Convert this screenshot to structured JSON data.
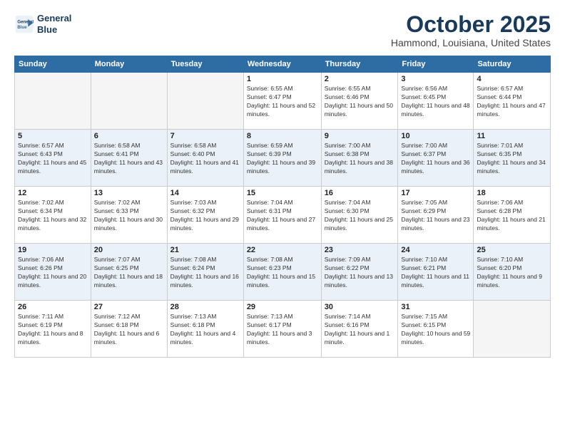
{
  "header": {
    "logo_line1": "General",
    "logo_line2": "Blue",
    "month": "October 2025",
    "location": "Hammond, Louisiana, United States"
  },
  "weekdays": [
    "Sunday",
    "Monday",
    "Tuesday",
    "Wednesday",
    "Thursday",
    "Friday",
    "Saturday"
  ],
  "weeks": [
    [
      {
        "day": "",
        "empty": true
      },
      {
        "day": "",
        "empty": true
      },
      {
        "day": "",
        "empty": true
      },
      {
        "day": "1",
        "sunrise": "6:55 AM",
        "sunset": "6:47 PM",
        "daylight": "11 hours and 52 minutes."
      },
      {
        "day": "2",
        "sunrise": "6:55 AM",
        "sunset": "6:46 PM",
        "daylight": "11 hours and 50 minutes."
      },
      {
        "day": "3",
        "sunrise": "6:56 AM",
        "sunset": "6:45 PM",
        "daylight": "11 hours and 48 minutes."
      },
      {
        "day": "4",
        "sunrise": "6:57 AM",
        "sunset": "6:44 PM",
        "daylight": "11 hours and 47 minutes."
      }
    ],
    [
      {
        "day": "5",
        "sunrise": "6:57 AM",
        "sunset": "6:43 PM",
        "daylight": "11 hours and 45 minutes."
      },
      {
        "day": "6",
        "sunrise": "6:58 AM",
        "sunset": "6:41 PM",
        "daylight": "11 hours and 43 minutes."
      },
      {
        "day": "7",
        "sunrise": "6:58 AM",
        "sunset": "6:40 PM",
        "daylight": "11 hours and 41 minutes."
      },
      {
        "day": "8",
        "sunrise": "6:59 AM",
        "sunset": "6:39 PM",
        "daylight": "11 hours and 39 minutes."
      },
      {
        "day": "9",
        "sunrise": "7:00 AM",
        "sunset": "6:38 PM",
        "daylight": "11 hours and 38 minutes."
      },
      {
        "day": "10",
        "sunrise": "7:00 AM",
        "sunset": "6:37 PM",
        "daylight": "11 hours and 36 minutes."
      },
      {
        "day": "11",
        "sunrise": "7:01 AM",
        "sunset": "6:35 PM",
        "daylight": "11 hours and 34 minutes."
      }
    ],
    [
      {
        "day": "12",
        "sunrise": "7:02 AM",
        "sunset": "6:34 PM",
        "daylight": "11 hours and 32 minutes."
      },
      {
        "day": "13",
        "sunrise": "7:02 AM",
        "sunset": "6:33 PM",
        "daylight": "11 hours and 30 minutes."
      },
      {
        "day": "14",
        "sunrise": "7:03 AM",
        "sunset": "6:32 PM",
        "daylight": "11 hours and 29 minutes."
      },
      {
        "day": "15",
        "sunrise": "7:04 AM",
        "sunset": "6:31 PM",
        "daylight": "11 hours and 27 minutes."
      },
      {
        "day": "16",
        "sunrise": "7:04 AM",
        "sunset": "6:30 PM",
        "daylight": "11 hours and 25 minutes."
      },
      {
        "day": "17",
        "sunrise": "7:05 AM",
        "sunset": "6:29 PM",
        "daylight": "11 hours and 23 minutes."
      },
      {
        "day": "18",
        "sunrise": "7:06 AM",
        "sunset": "6:28 PM",
        "daylight": "11 hours and 21 minutes."
      }
    ],
    [
      {
        "day": "19",
        "sunrise": "7:06 AM",
        "sunset": "6:26 PM",
        "daylight": "11 hours and 20 minutes."
      },
      {
        "day": "20",
        "sunrise": "7:07 AM",
        "sunset": "6:25 PM",
        "daylight": "11 hours and 18 minutes."
      },
      {
        "day": "21",
        "sunrise": "7:08 AM",
        "sunset": "6:24 PM",
        "daylight": "11 hours and 16 minutes."
      },
      {
        "day": "22",
        "sunrise": "7:08 AM",
        "sunset": "6:23 PM",
        "daylight": "11 hours and 15 minutes."
      },
      {
        "day": "23",
        "sunrise": "7:09 AM",
        "sunset": "6:22 PM",
        "daylight": "11 hours and 13 minutes."
      },
      {
        "day": "24",
        "sunrise": "7:10 AM",
        "sunset": "6:21 PM",
        "daylight": "11 hours and 11 minutes."
      },
      {
        "day": "25",
        "sunrise": "7:10 AM",
        "sunset": "6:20 PM",
        "daylight": "11 hours and 9 minutes."
      }
    ],
    [
      {
        "day": "26",
        "sunrise": "7:11 AM",
        "sunset": "6:19 PM",
        "daylight": "11 hours and 8 minutes."
      },
      {
        "day": "27",
        "sunrise": "7:12 AM",
        "sunset": "6:18 PM",
        "daylight": "11 hours and 6 minutes."
      },
      {
        "day": "28",
        "sunrise": "7:13 AM",
        "sunset": "6:18 PM",
        "daylight": "11 hours and 4 minutes."
      },
      {
        "day": "29",
        "sunrise": "7:13 AM",
        "sunset": "6:17 PM",
        "daylight": "11 hours and 3 minutes."
      },
      {
        "day": "30",
        "sunrise": "7:14 AM",
        "sunset": "6:16 PM",
        "daylight": "11 hours and 1 minute."
      },
      {
        "day": "31",
        "sunrise": "7:15 AM",
        "sunset": "6:15 PM",
        "daylight": "10 hours and 59 minutes."
      },
      {
        "day": "",
        "empty": true
      }
    ]
  ]
}
